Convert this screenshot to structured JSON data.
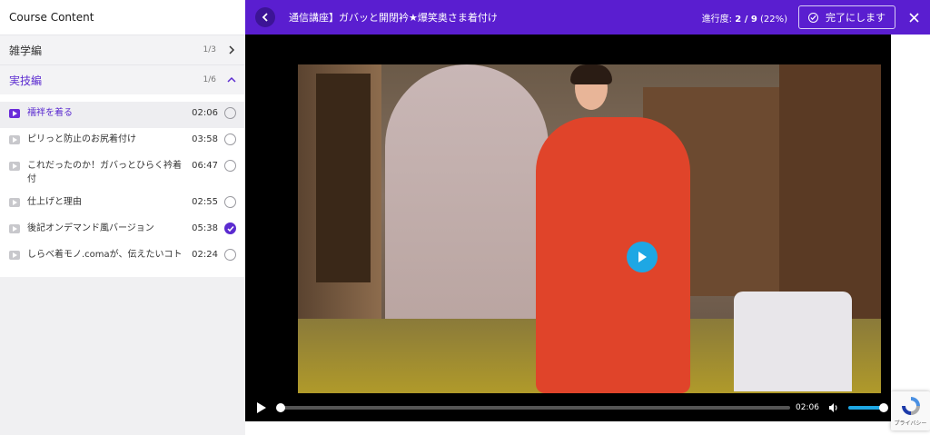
{
  "sidebar": {
    "header": "Course Content",
    "sections": [
      {
        "title": "雑学編",
        "count": "1/3",
        "expanded": false
      },
      {
        "title": "実技編",
        "count": "1/6",
        "expanded": true
      }
    ],
    "lessons": [
      {
        "title": "襦袢を着る",
        "duration": "02:06",
        "completed": false,
        "current": true
      },
      {
        "title": "ピリっと防止のお尻着付け",
        "duration": "03:58",
        "completed": false,
        "current": false
      },
      {
        "title": "これだったのか！ガバっとひらく衿着付",
        "duration": "06:47",
        "completed": false,
        "current": false
      },
      {
        "title": "仕上げと理由",
        "duration": "02:55",
        "completed": false,
        "current": false
      },
      {
        "title": "後記オンデマンド風バージョン",
        "duration": "05:38",
        "completed": true,
        "current": false
      },
      {
        "title": "しらべ着モノ.comaが、伝えたいコト",
        "duration": "02:24",
        "completed": false,
        "current": false
      }
    ]
  },
  "topbar": {
    "lesson_title": "通信講座】ガバッと開閉衿★爆笑奥さま着付け",
    "progress_label": "進行度:",
    "progress_value": "2 / 9",
    "progress_percent": "(22%)",
    "complete_label": "完了にします"
  },
  "player": {
    "time": "02:06",
    "seek_progress": 0,
    "volume": 1.0
  },
  "recaptcha": {
    "text": "プライバシー"
  },
  "colors": {
    "brand": "#5a1ed0",
    "accent": "#1ea7e4",
    "completed": "#5b2bd0"
  }
}
